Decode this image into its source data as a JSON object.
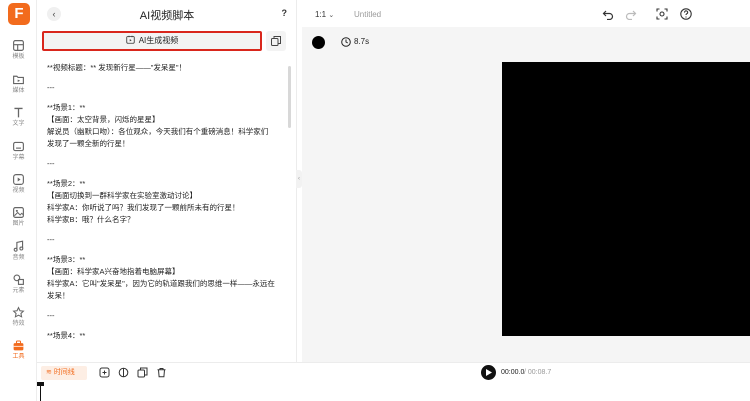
{
  "app": {
    "logo_letter": "F"
  },
  "rail": {
    "items": [
      {
        "label": "模板",
        "icon": "template-icon"
      },
      {
        "label": "媒体",
        "icon": "media-icon"
      },
      {
        "label": "文字",
        "icon": "text-icon"
      },
      {
        "label": "字幕",
        "icon": "subtitle-icon"
      },
      {
        "label": "视频",
        "icon": "video-icon"
      },
      {
        "label": "图片",
        "icon": "image-icon"
      },
      {
        "label": "音频",
        "icon": "audio-icon"
      },
      {
        "label": "元素",
        "icon": "elements-icon"
      },
      {
        "label": "特效",
        "icon": "effects-icon"
      },
      {
        "label": "工具",
        "icon": "tools-icon",
        "active": true
      }
    ]
  },
  "panel": {
    "back": "‹",
    "title": "AI视频脚本",
    "help": "?",
    "generate_label": "AI生成视频",
    "script_lines": [
      "**视频标题：** 发现新行星——\"发呆星\"！",
      "",
      "---",
      "",
      "**场景1：**",
      "【画面：太空背景，闪烁的星星】",
      "解说员（幽默口吻）：各位观众，今天我们有个重磅消息！科学家们",
      "发现了一颗全新的行星！",
      "",
      "---",
      "",
      "**场景2：**",
      "【画面切换到一群科学家在实验室激动讨论】",
      "科学家A：你听说了吗？我们发现了一颗前所未有的行星！",
      "科学家B：哦？什么名字？",
      "",
      "---",
      "",
      "**场景3：**",
      "【画面：科学家A兴奋地指着电脑屏幕】",
      "科学家A：它叫\"发呆星\"，因为它的轨道跟我们的思维一样——永远在",
      "发呆！",
      "",
      "---",
      "",
      "**场景4：**"
    ]
  },
  "toolbar": {
    "ratio": "1:1",
    "doc_title": "Untitled",
    "duration": "8.7s"
  },
  "timeline": {
    "button_label": "时间线",
    "current_time": "00:00.0",
    "total_time": "/ 00:08.7"
  },
  "colors": {
    "accent": "#f26b1d",
    "highlight_border": "#d9261c",
    "preview": "#000000"
  }
}
